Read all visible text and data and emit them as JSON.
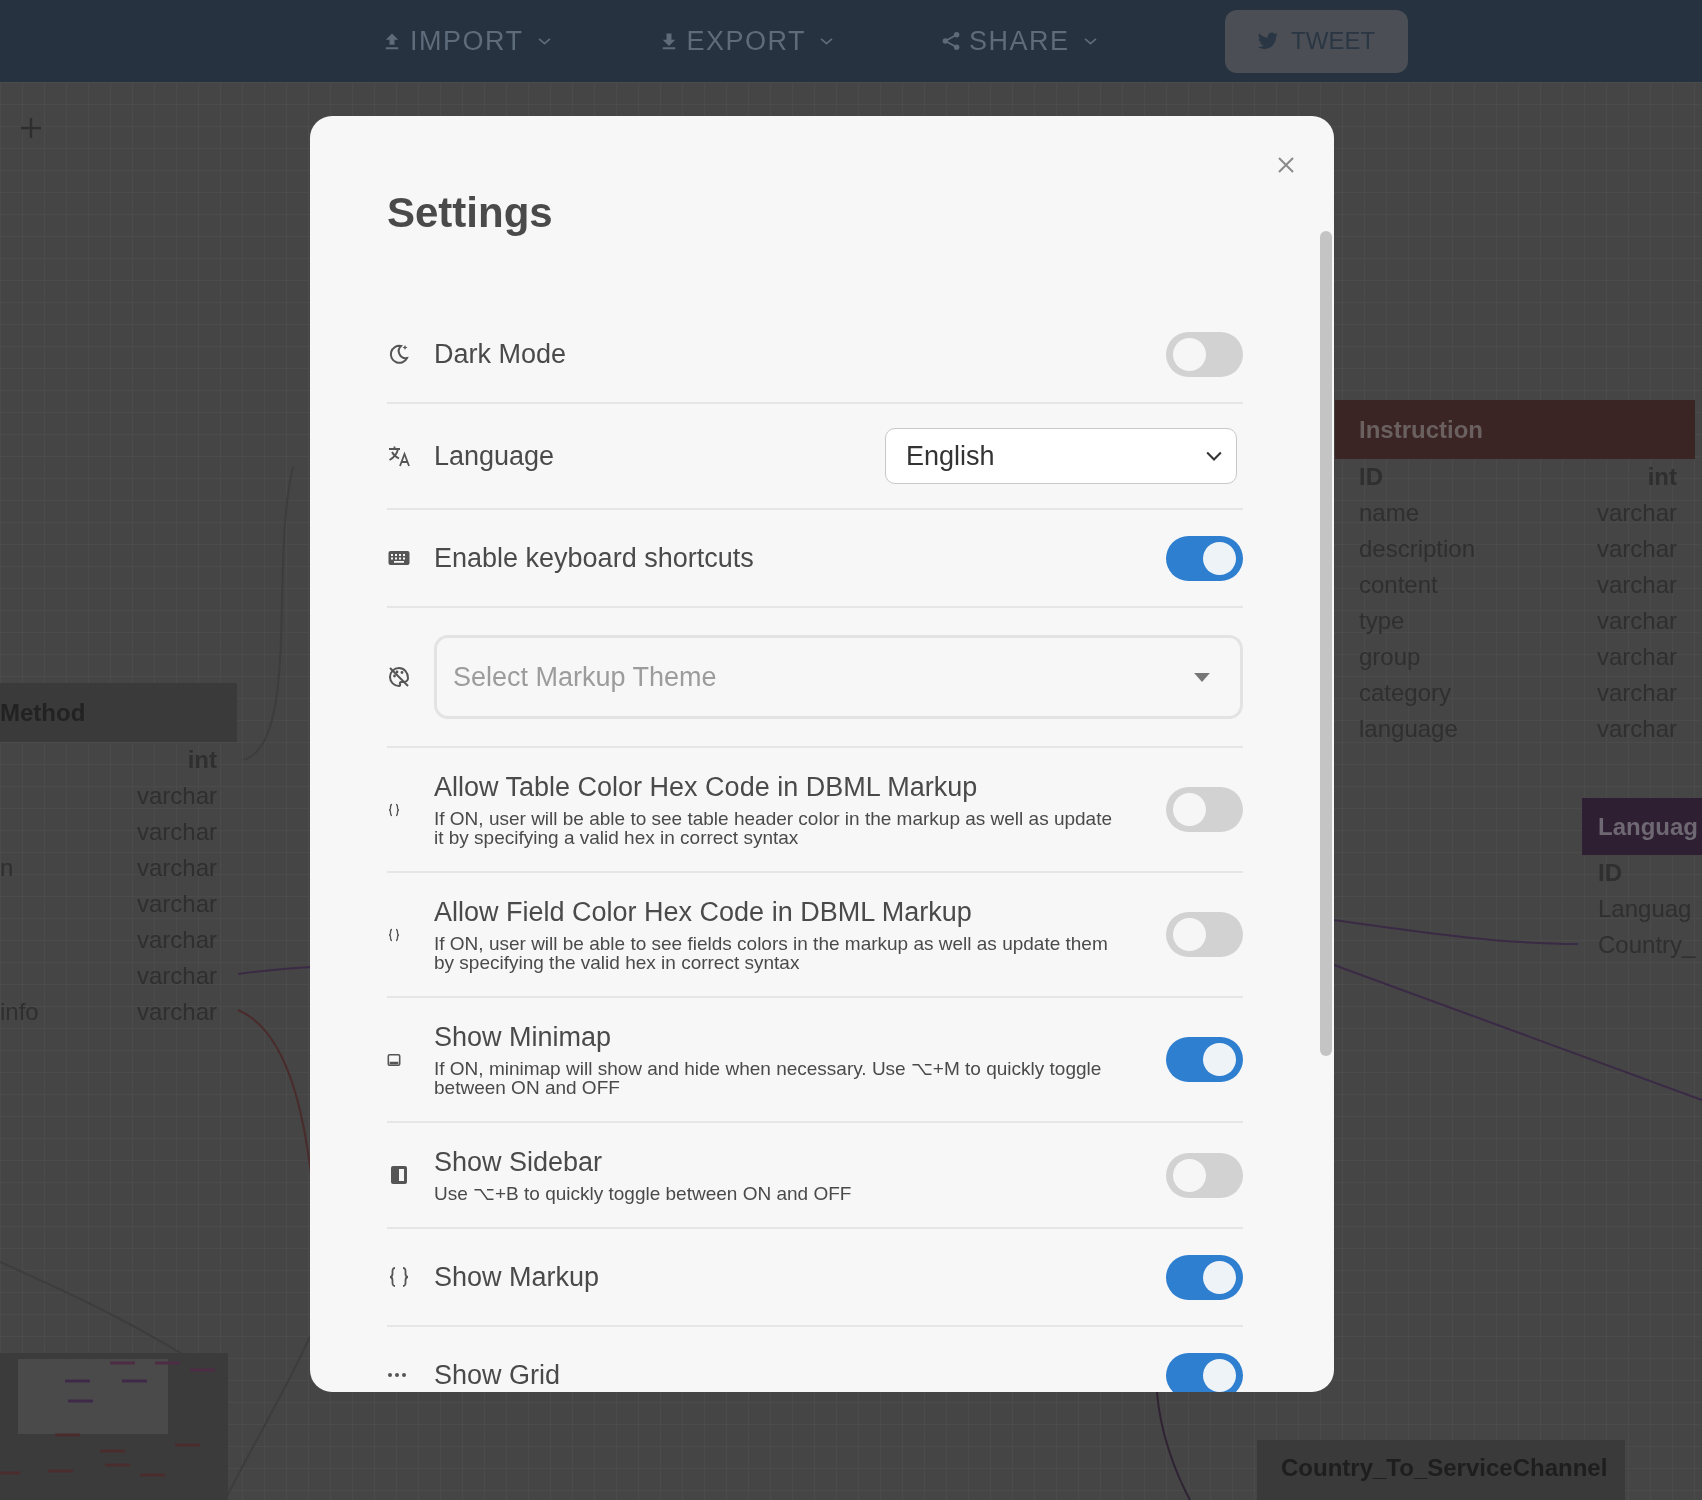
{
  "toolbar": {
    "menus": [
      {
        "label": "IMPORT",
        "kind": "upload"
      },
      {
        "label": "EXPORT",
        "kind": "download"
      },
      {
        "label": "SHARE",
        "kind": "share"
      }
    ],
    "tweet_button": "TWEET"
  },
  "canvas": {
    "tables": [
      {
        "title": "Method",
        "color": "#3a3a3a",
        "fields": [
          {
            "type": "int",
            "primary": true
          },
          {
            "type": "varchar",
            "primary": false
          },
          {
            "type": "varchar",
            "primary": false
          },
          {
            "name": "n",
            "type": "varchar",
            "primary": false
          },
          {
            "type": "varchar",
            "primary": false
          },
          {
            "type": "varchar",
            "primary": false
          },
          {
            "type": "varchar",
            "primary": false
          },
          {
            "name": "info",
            "type": "varchar",
            "primary": false
          }
        ]
      },
      {
        "title": "Instruction",
        "color": "#3b2424",
        "fields": [
          {
            "name": "ID",
            "type": "int",
            "primary": true
          },
          {
            "name": "name",
            "type": "varchar",
            "primary": false
          },
          {
            "name": "description",
            "type": "varchar",
            "primary": false
          },
          {
            "name": "content",
            "type": "varchar",
            "primary": false
          },
          {
            "name": "type",
            "type": "varchar",
            "primary": false
          },
          {
            "name": "group",
            "type": "varchar",
            "primary": false
          },
          {
            "name": "category",
            "type": "varchar",
            "primary": false
          },
          {
            "name": "language",
            "type": "varchar",
            "primary": false
          }
        ]
      },
      {
        "title": "Languag",
        "color": "#2e1f33",
        "fields": [
          {
            "name": "ID",
            "primary": true
          },
          {
            "name": "Languag",
            "primary": false
          },
          {
            "name": "Country_",
            "primary": false
          }
        ]
      },
      {
        "title": "Country_To_ServiceChannel",
        "color": "#3a3a3a"
      }
    ]
  },
  "settings_dialog": {
    "title": "Settings",
    "rows": [
      {
        "kind": "toggle",
        "label": "Dark Mode",
        "on": false
      },
      {
        "kind": "select",
        "label": "Language",
        "value": "English"
      },
      {
        "kind": "toggle",
        "label": "Enable keyboard shortcuts",
        "on": true
      },
      {
        "kind": "theme",
        "placeholder": "Select Markup Theme"
      },
      {
        "kind": "toggle",
        "label": "Allow Table Color Hex Code in DBML Markup",
        "description": "If ON, user will be able to see table header color in the markup as well as update it by specifying a valid hex in correct syntax",
        "on": false
      },
      {
        "kind": "toggle",
        "label": "Allow Field Color Hex Code in DBML Markup",
        "description": "If ON, user will be able to see fields colors in the markup as well as update them by specifying the valid hex in correct syntax",
        "on": false
      },
      {
        "kind": "toggle",
        "label": "Show Minimap",
        "description": "If ON, minimap will show and hide when necessary. Use ⌥+M to quickly toggle between ON and OFF",
        "on": true
      },
      {
        "kind": "toggle",
        "label": "Show Sidebar",
        "description": "Use ⌥+B to quickly toggle between ON and OFF",
        "on": false
      },
      {
        "kind": "toggle",
        "label": "Show Markup",
        "on": true
      },
      {
        "kind": "toggle",
        "label": "Show Grid",
        "on": true
      }
    ]
  }
}
